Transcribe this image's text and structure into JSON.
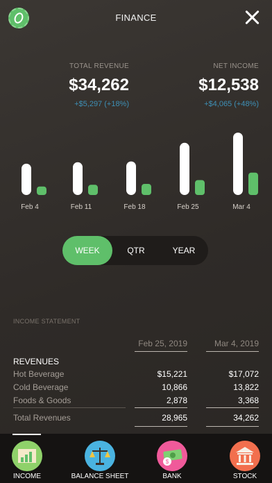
{
  "header": {
    "title": "FINANCE"
  },
  "kpis": {
    "revenue": {
      "label": "TOTAL REVENUE",
      "value": "$34,262",
      "delta": "+$5,297  (+18%)"
    },
    "net": {
      "label": "NET INCOME",
      "value": "$12,538",
      "delta": "+$4,065  (+48%)"
    }
  },
  "chart_data": {
    "type": "bar",
    "categories": [
      "Feb 4",
      "Feb 11",
      "Feb 18",
      "Feb 25",
      "Mar 4"
    ],
    "series": [
      {
        "values": [
          22100,
          23100,
          23700,
          36800,
          44000
        ]
      },
      {
        "values": [
          6000,
          7200,
          7800,
          10500,
          15800
        ]
      }
    ],
    "ylim": [
      0,
      46000
    ],
    "colors": [
      "#ffffff",
      "#5fbf6a"
    ]
  },
  "period_toggle": {
    "options": [
      "WEEK",
      "QTR",
      "YEAR"
    ],
    "selected": "WEEK"
  },
  "income_statement": {
    "label": "INCOME STATEMENT",
    "columns": [
      "Feb 25, 2019",
      "Mar 4, 2019"
    ],
    "revenues_header": "REVENUES",
    "rows": [
      {
        "label": "Hot Beverage",
        "v1": "$15,221",
        "v2": "$17,072"
      },
      {
        "label": "Cold Beverage",
        "v1": "10,866",
        "v2": "13,822"
      },
      {
        "label": "Foods & Goods",
        "v1": "2,878",
        "v2": "3,368"
      }
    ],
    "total": {
      "label": "Total Revenues",
      "v1": "28,965",
      "v2": "34,262"
    }
  },
  "tabs": [
    {
      "label": "INCOME",
      "icon": "income-chart-icon",
      "color": "#8fd16a"
    },
    {
      "label": "BALANCE SHEET",
      "icon": "scales-icon",
      "color": "#4ab3e0"
    },
    {
      "label": "BANK",
      "icon": "money-icon",
      "color": "#f05a9a"
    },
    {
      "label": "STOCK",
      "icon": "bank-building-icon",
      "color": "#f26f4e"
    }
  ],
  "active_tab": "INCOME"
}
